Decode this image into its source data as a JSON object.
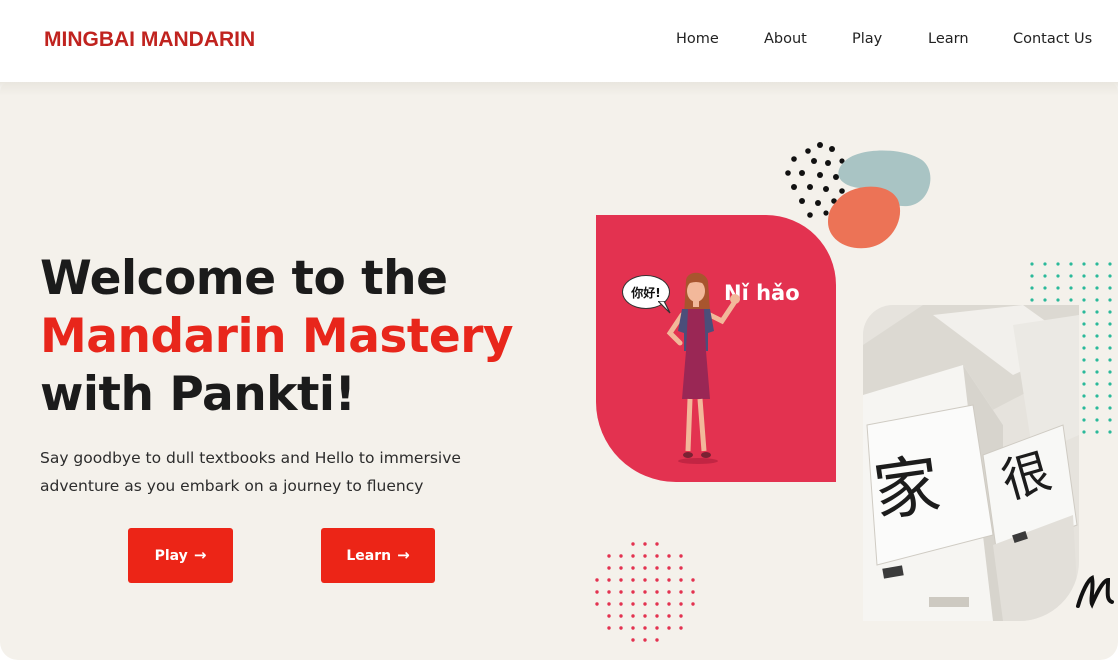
{
  "brand": {
    "name": "MINGBAI MANDARIN"
  },
  "nav": {
    "items": [
      {
        "label": "Home"
      },
      {
        "label": "About"
      },
      {
        "label": "Play"
      },
      {
        "label": "Learn"
      },
      {
        "label": "Contact Us"
      }
    ]
  },
  "hero": {
    "headline_line1": "Welcome to the",
    "headline_accent": "Mandarin Mastery",
    "headline_line3": "with Pankti!",
    "subtext": "Say goodbye to dull textbooks and Hello to immersive adventure as you embark on a journey to fluency",
    "play_label": "Play",
    "learn_label": "Learn",
    "arrow_icon": "arrow-right-icon"
  },
  "illustration": {
    "greeting_pinyin": "Nǐ hǎo",
    "speech_bubble": "你好!"
  },
  "photo": {
    "card_char_1": "家",
    "card_char_2": "很"
  },
  "colors": {
    "brand_red": "#c0231f",
    "accent_red": "#e8261b",
    "button_red": "#ec2517",
    "card_pink": "#e33250",
    "hero_bg": "#f4f1eb",
    "teal_dots": "#2bb99a",
    "coral_blob": "#ec7356",
    "sage_blob": "#a9c4c4"
  }
}
